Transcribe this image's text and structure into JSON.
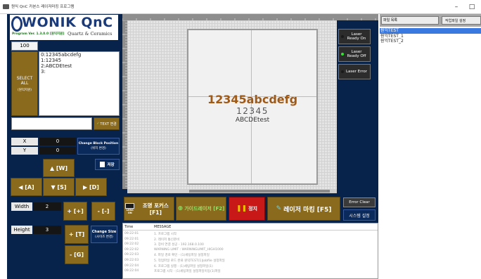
{
  "window": {
    "title": "원익 QnC 카본스 레이저마킹 프로그램",
    "minimize": "–",
    "maximize": "□"
  },
  "colors": {
    "gold": "#8a6a1c",
    "navy": "#0b2a5c",
    "red": "#c81818",
    "logo_blue": "#1a3a7a",
    "log_dim": "#9a9a9a"
  },
  "logo": {
    "company": "WONIK QnC",
    "subtitle": "Quartz & Ceramics",
    "program_ver": "Program Ver. 1.3.0.0 [원익지원]"
  },
  "marking": {
    "count": "100",
    "select_all_label": "SELECT\nALL",
    "select_all_sub": "(원익지원)",
    "lines": [
      "0:12345abcdefg",
      "1:12345",
      "2:ABCDEtest",
      "3:"
    ],
    "text_input": "",
    "text_change_button": "TEXT 변경"
  },
  "position": {
    "x_label": "X",
    "x_value": "0",
    "y_label": "Y",
    "y_value": "0",
    "change_block_title": "Change Block Position",
    "change_block_sub": "(위치 변경)",
    "save_label": "저장",
    "up": "▲ [W]",
    "left": "◀ [A]",
    "down": "▼ [S]",
    "right": "▶ [D]"
  },
  "size": {
    "width_label": "Width",
    "width_value": "2",
    "height_label": "Height",
    "height_value": "3",
    "plus_f": "+ [+]",
    "minus_f": "- [-]",
    "plus_t": "+ [T]",
    "minus_g": "- [G]",
    "change_size_title": "Change Size",
    "change_size_sub": "(사이즈 변경)"
  },
  "preview": {
    "line1": "12345abcdefg",
    "line2": "12345",
    "line3": "ABCDEtest"
  },
  "laser_status": [
    {
      "label": "Laser\nReady On",
      "led": "#1a1a1a"
    },
    {
      "label": "Laser\nReady Off",
      "led": "#2ee62e"
    },
    {
      "label": "Laser Error",
      "led": "#1a1a1a"
    }
  ],
  "actions": {
    "aim": "조명 포커스 [F1]",
    "aim_icon_caption": "LENS ON",
    "guide": "가이드레이저 [F2]",
    "stop": "정지",
    "mark": "레이저 마킹 [F5]",
    "error_clear": "Error Clear",
    "system_settings": "시스템 설정"
  },
  "log": {
    "headers": [
      "Time",
      "MESSAGE"
    ],
    "rows": [
      [
        "09:22:01",
        "1. 프로그램 시작"
      ],
      [
        "09:22:01",
        "2. 레이저 통신준비"
      ],
      [
        "09:22:02",
        "3. 장비 연결 성공 - 192.168.0.100"
      ],
      [
        "09:22:02",
        "WARNING LIMIT : WARNINGLIMIT_HIGH1000"
      ],
      [
        "09:22:03",
        "4. 파일 경로 확인 - (1)세팅파일 설정파일"
      ],
      [
        "09:22:03",
        "5. 작업파일 로드 완료 원익TEST(1)Jobfile 설정파일"
      ],
      [
        "09:22:04",
        "6. 프로그램 실행 - (1)세팅파일 설정파일(1)"
      ],
      [
        "09:22:04",
        "프로그램 시작 - (1)세팅파일 설정파일이동(1)파일"
      ]
    ]
  },
  "right_panel": {
    "list_header": "파일 목록",
    "file_settings_button": "작업파일 설정",
    "files": [
      "원익TEST",
      "원익TEST_1",
      "원익TEST_2"
    ]
  }
}
